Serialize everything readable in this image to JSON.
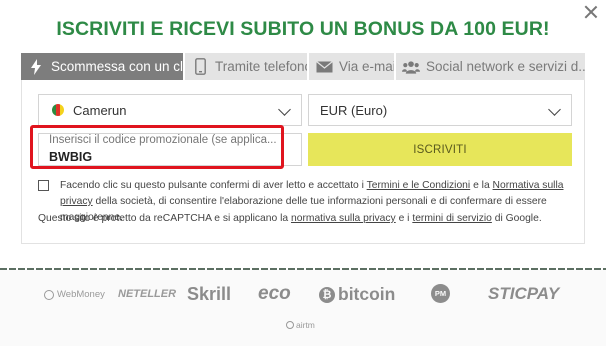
{
  "modal": {
    "title": "ISCRIVITI E RICEVI SUBITO UN BONUS DA 100 EUR!"
  },
  "tabs": [
    {
      "label": "Scommessa con un clic",
      "icon": "lightning-icon",
      "active": true
    },
    {
      "label": "Tramite telefono",
      "icon": "phone-icon",
      "active": false
    },
    {
      "label": "Via e-mail",
      "icon": "envelope-icon",
      "active": false
    },
    {
      "label": "Social network e servizi d...",
      "icon": "users-icon",
      "active": false
    }
  ],
  "form": {
    "country": "Camerun",
    "currency": "EUR (Euro)",
    "promo_placeholder": "Inserisci il codice promozionale (se applica...",
    "promo_value": "BWBIG",
    "submit_label": "ISCRIVITI"
  },
  "consent": {
    "before": "Facendo clic su questo pulsante confermi di aver letto e accettato i ",
    "terms_link": "Termini e le Condizioni",
    "middle": " e la ",
    "privacy_link": "Normativa sulla privacy",
    "after": " della società, di consentire l'elaborazione delle tue informazioni personali e di confermare di essere maggiorenne."
  },
  "recaptcha": {
    "before": "Questo sito è protetto da reCAPTCHA e si applicano la ",
    "privacy_link": "normativa sulla privacy",
    "middle": " e i ",
    "terms_link": "termini di servizio",
    "after": " di Google."
  },
  "payments": {
    "webmoney": "WebMoney",
    "neteller": "NETELLER",
    "skrill": "Skrill",
    "eco": "eco",
    "bitcoin": "bitcoin",
    "pm": "PM",
    "sticpay": "STICPAY",
    "airtm": "airtm"
  },
  "colors": {
    "title_green": "#2e8a46",
    "submit_yellow": "#e7e65a",
    "highlight_red": "#e0141e",
    "active_tab": "#7d7d7d"
  }
}
